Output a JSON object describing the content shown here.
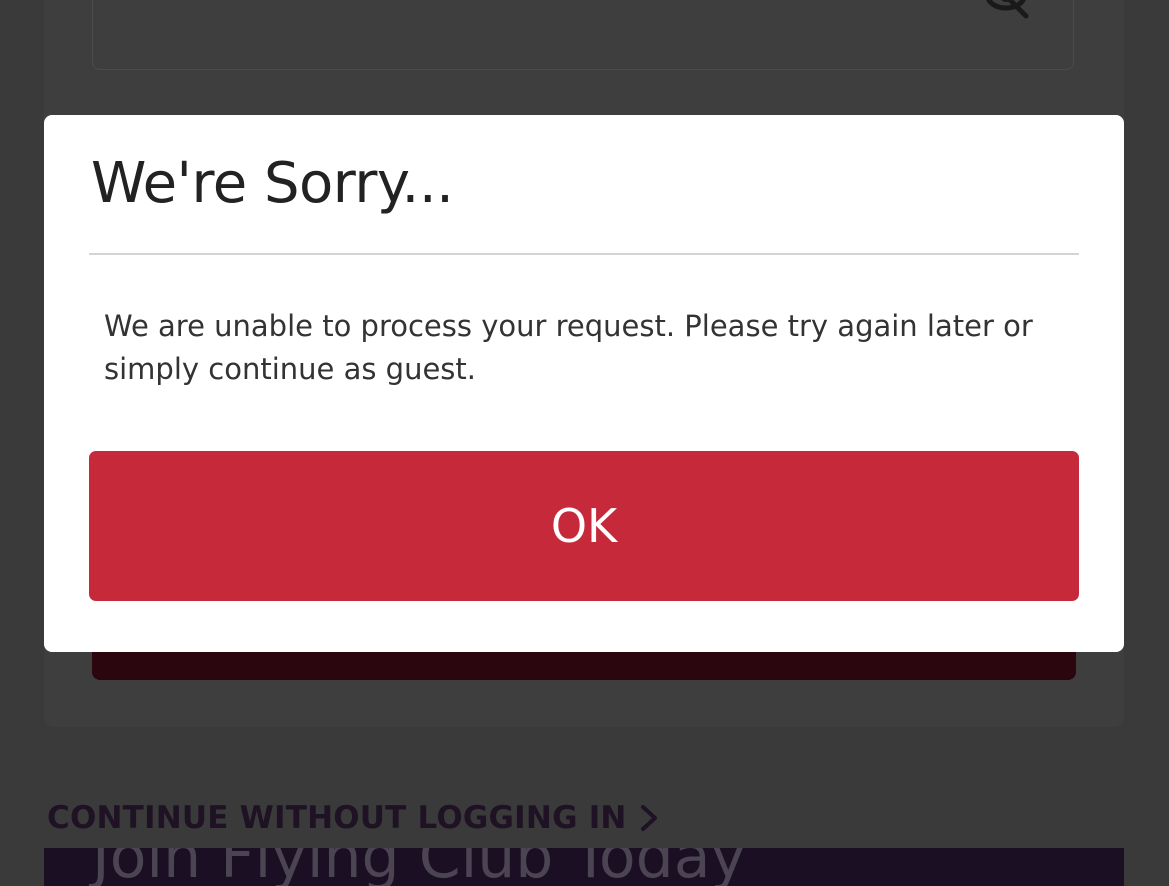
{
  "background": {
    "continue_link_label": "CONTINUE WITHOUT LOGGING IN",
    "promo_text": "Join Flying Club Today",
    "icons": [
      "eye-slash-icon",
      "chevron-right-icon"
    ]
  },
  "modal": {
    "title": "We're Sorry...",
    "message": "We are unable to process your request. Please try again later or simply continue as guest.",
    "ok_label": "OK"
  },
  "colors": {
    "primary_button": "#c62a3a",
    "overlay": "#3a3a3a",
    "modal_background": "#ffffff"
  }
}
